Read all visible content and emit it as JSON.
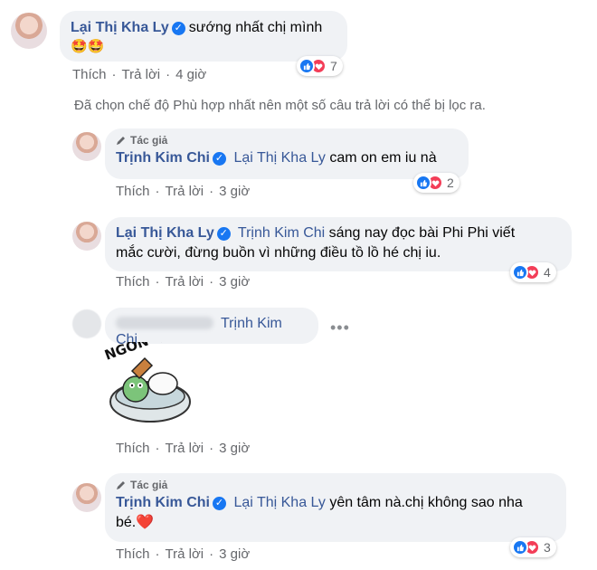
{
  "comment1": {
    "author": "Lại Thị Kha Ly",
    "text": "sướng nhất chị mình",
    "emoji": "🤩🤩",
    "actions": {
      "like": "Thích",
      "reply": "Trả lời",
      "time": "4 giờ"
    },
    "reaction_count": "7"
  },
  "filter_notice": "Đã chọn chế độ Phù hợp nhất nên một số câu trả lời có thể bị lọc ra.",
  "reply1": {
    "badge": "Tác giả",
    "author": "Trịnh Kim Chi",
    "mention": "Lại Thị Kha Ly",
    "text": "cam on em iu nà",
    "actions": {
      "like": "Thích",
      "reply": "Trả lời",
      "time": "3 giờ"
    },
    "reaction_count": "2"
  },
  "reply2": {
    "author": "Lại Thị Kha Ly",
    "mention": "Trịnh Kim Chi",
    "text_line1": "sáng nay đọc bài Phi Phi viết",
    "text_line2": "mắc cười, đừng buồn vì những điều tồ lồ hé chị iu.",
    "actions": {
      "like": "Thích",
      "reply": "Trả lời",
      "time": "3 giờ"
    },
    "reaction_count": "4"
  },
  "reply3": {
    "mention": "Trịnh Kim Chi",
    "more_icon": "more-horizontal-icon",
    "sticker_text": "NGON QUÁ!!",
    "actions": {
      "like": "Thích",
      "reply": "Trả lời",
      "time": "3 giờ"
    }
  },
  "reply4": {
    "badge": "Tác giả",
    "author": "Trịnh Kim Chi",
    "mention": "Lại Thị Kha Ly",
    "text_line1": "yên tâm nà.chị không sao nha",
    "text_line2": "bé.",
    "emoji": "❤️",
    "actions": {
      "like": "Thích",
      "reply": "Trả lời",
      "time": "3 giờ"
    },
    "reaction_count": "3"
  },
  "colors": {
    "link": "#385898",
    "bubble": "#f0f2f5",
    "meta": "#65676b",
    "like": "#1877f2",
    "love": "#f33e58"
  }
}
